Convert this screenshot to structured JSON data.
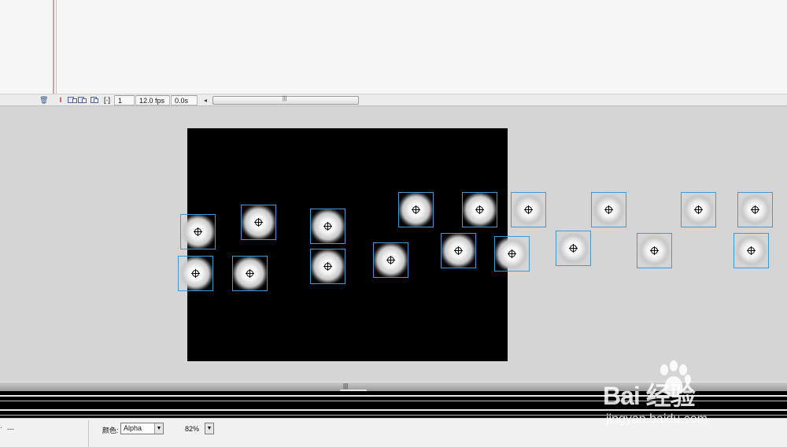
{
  "timeline_bar": {
    "frame_number": "1",
    "frame_rate": "12.0 fps",
    "elapsed_time": "0.0s",
    "scroll_left_glyph": "◂",
    "scroll_grip_glyph": "|||"
  },
  "icons": {
    "trash": "🗑",
    "onion_skin": "ǀ",
    "edit_multiple": "[·]"
  },
  "properties": {
    "left_value": "---",
    "dot": "·",
    "color_label": "颜色:",
    "color_mode": "Alpha",
    "alpha_value": "82%",
    "dropdown_arrow": "▼"
  },
  "splitter": {
    "grip": "|||"
  },
  "watermark": {
    "brand": "Bai  经验",
    "url": "jingyan.baidu.com"
  },
  "colors": {
    "stage_background": "#000000",
    "workspace": "#d5d5d5",
    "selection_outline": "#3f9ad8",
    "playhead": "#c20000"
  }
}
